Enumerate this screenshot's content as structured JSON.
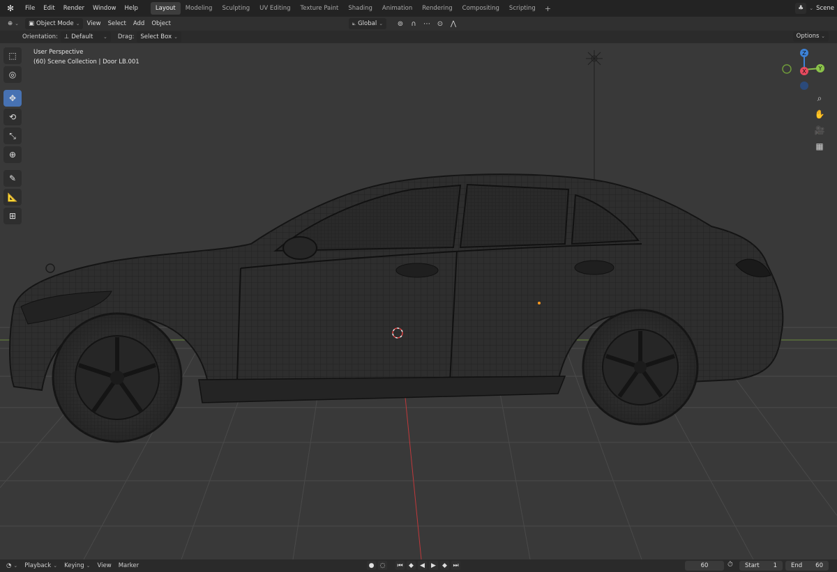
{
  "menu": [
    "File",
    "Edit",
    "Render",
    "Window",
    "Help"
  ],
  "workspaces": [
    "Layout",
    "Modeling",
    "Sculpting",
    "UV Editing",
    "Texture Paint",
    "Shading",
    "Animation",
    "Rendering",
    "Compositing",
    "Scripting"
  ],
  "active_workspace": "Layout",
  "scene_label": "Scene",
  "header": {
    "mode": "Object Mode",
    "view": "View",
    "select": "Select",
    "add": "Add",
    "object": "Object",
    "transform_orientation": "Global"
  },
  "tool_settings": {
    "orientation_label": "Orientation:",
    "orientation_value": "Default",
    "drag_label": "Drag:",
    "drag_value": "Select Box",
    "options": "Options"
  },
  "viewport": {
    "perspective": "User Perspective",
    "collection_info": "(60) Scene Collection | Door LB.001"
  },
  "gizmo": {
    "z": "Z",
    "x": "X",
    "y": "Y"
  },
  "timeline": {
    "playback": "Playback",
    "keying": "Keying",
    "view": "View",
    "marker": "Marker",
    "current_frame": "60",
    "start_label": "Start",
    "start": "1",
    "end_label": "End",
    "end": "60"
  },
  "colors": {
    "accent": "#4772b3",
    "viewport_bg": "#393939",
    "x_axis": "#e84a5f",
    "y_axis": "#8bc34a",
    "z_axis": "#3d82d6"
  }
}
